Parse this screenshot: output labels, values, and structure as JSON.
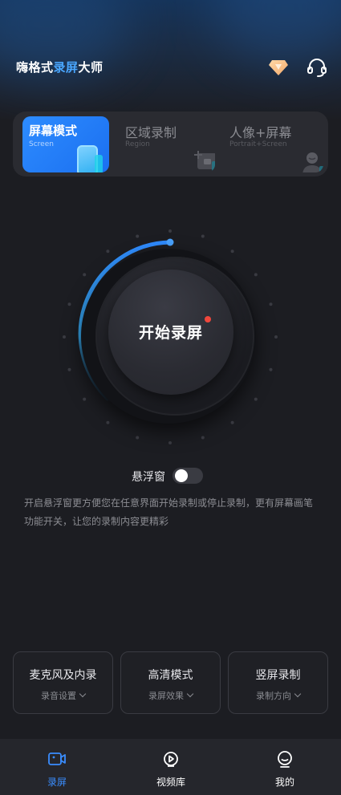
{
  "app": {
    "title_part1": "嗨格式",
    "title_part2": "录屏",
    "title_part3": "大师"
  },
  "header": {
    "vip_icon": "diamond-vip-icon",
    "support_icon": "headset-support-icon"
  },
  "modes": [
    {
      "label": "屏幕模式",
      "sub": "Screen",
      "active": true
    },
    {
      "label": "区域录制",
      "sub": "Region",
      "active": false
    },
    {
      "label": "人像+屏幕",
      "sub": "Portrait+Screen",
      "active": false
    }
  ],
  "record": {
    "start_label": "开始录屏"
  },
  "floating": {
    "label": "悬浮窗",
    "enabled": false,
    "description": "开启悬浮窗更方便您在任意界面开始录制或停止录制，更有屏幕画笔功能开关，让您的录制内容更精彩"
  },
  "features": [
    {
      "title": "麦克风及内录",
      "sub": "录音设置"
    },
    {
      "title": "高清模式",
      "sub": "录屏效果"
    },
    {
      "title": "竖屏录制",
      "sub": "录制方向"
    }
  ],
  "tabs": [
    {
      "label": "录屏",
      "icon": "record-camera-icon",
      "active": true
    },
    {
      "label": "视频库",
      "icon": "video-library-icon",
      "active": false
    },
    {
      "label": "我的",
      "icon": "profile-icon",
      "active": false
    }
  ],
  "colors": {
    "accent": "#2d8cff",
    "background": "#1c1d22",
    "record_dot": "#f0473c"
  }
}
